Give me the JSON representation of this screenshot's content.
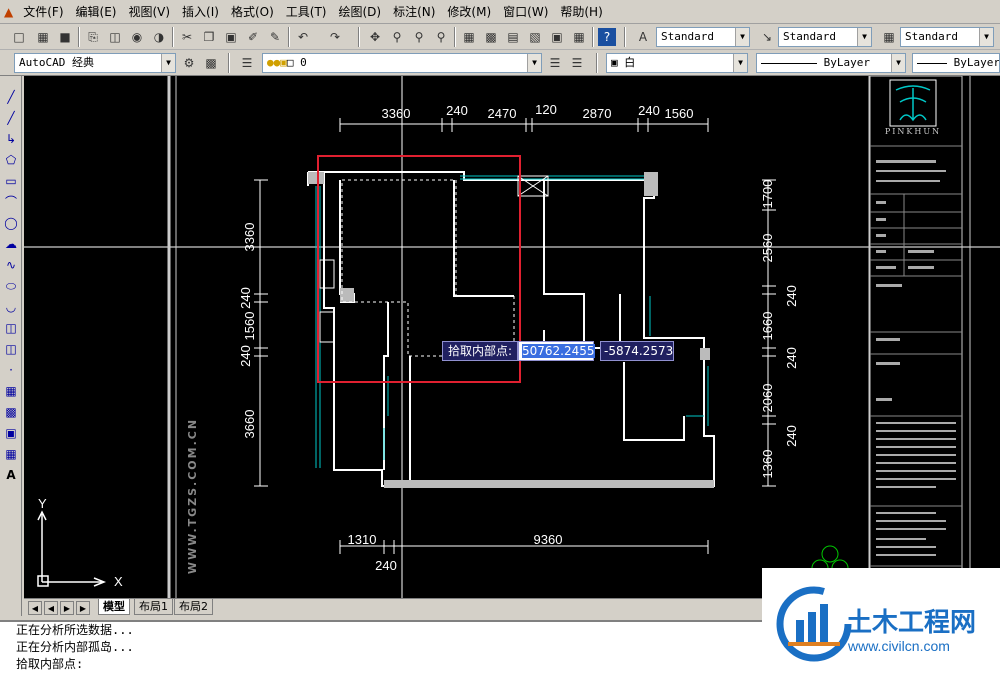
{
  "menu": [
    "文件(F)",
    "编辑(E)",
    "视图(V)",
    "插入(I)",
    "格式(O)",
    "工具(T)",
    "绘图(D)",
    "标注(N)",
    "修改(M)",
    "窗口(W)",
    "帮助(H)"
  ],
  "toolbar1": {
    "text_style": "Standard",
    "dim_style": "Standard",
    "table_style": "Standard"
  },
  "toolbar2": {
    "workspace": "AutoCAD 经典",
    "layer": "0",
    "color": "白",
    "linetype": "ByLayer",
    "lineweight": "ByLayer"
  },
  "drawing": {
    "top_dims": [
      "3360",
      "240",
      "2470",
      "120",
      "2870",
      "240",
      "1560"
    ],
    "left_dims": [
      "3360",
      "240",
      "1560",
      "240",
      "3660"
    ],
    "right_dims": [
      "1700",
      "2560",
      "240",
      "1660",
      "240",
      "2060",
      "240",
      "1360"
    ],
    "bottom_dims": [
      "1310",
      "9360"
    ],
    "bottom_extra": "240",
    "watermark": "WWW.TGZS.COM.CN",
    "ucs_x": "X",
    "ucs_y": "Y",
    "titleblock_brand": "PINKHUN"
  },
  "input": {
    "prompt": "拾取内部点:",
    "x_value": "50762.2455",
    "y_value": "-5874.2573"
  },
  "layout_tabs": [
    "模型",
    "布局1",
    "布局2"
  ],
  "command_lines": [
    "正在分析所选数据...",
    "正在分析内部孤岛...",
    "拾取内部点:"
  ],
  "logo": {
    "name": "土木工程网",
    "url": "www.civilcn.com"
  },
  "colors": {
    "highlight_rect": "#e02030",
    "dim_text": "#ffffff",
    "wall": "#ffffff",
    "window": "#00c8c8",
    "prompt_bg": "#202060",
    "logo_blue": "#1a6fc4"
  }
}
